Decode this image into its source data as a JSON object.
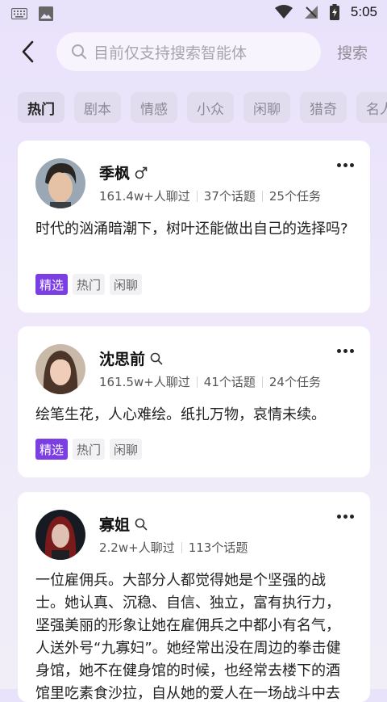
{
  "status_bar": {
    "time": "5:05"
  },
  "search": {
    "placeholder": "目前仅支持搜索智能体",
    "button_label": "搜索"
  },
  "tabs": [
    "热门",
    "剧本",
    "情感",
    "小众",
    "闲聊",
    "猎奇",
    "名人"
  ],
  "cards": [
    {
      "name": "季枫",
      "name_icon": "male-icon",
      "chats": "161.4w+人聊过",
      "topics": "37个话题",
      "tasks": "25个任务",
      "description": "时代的汹涌暗潮下，树叶还能做出自己的选择吗?",
      "tags": [
        "精选",
        "热门",
        "闲聊"
      ]
    },
    {
      "name": "沈思前",
      "name_icon": "search-icon",
      "chats": "161.5w+人聊过",
      "topics": "41个话题",
      "tasks": "24个任务",
      "description": "绘笔生花，人心难绘。纸扎万物，哀情未续。",
      "tags": [
        "精选",
        "热门",
        "闲聊"
      ]
    },
    {
      "name": "寡姐",
      "name_icon": "search-icon",
      "chats": "2.2w+人聊过",
      "topics": "113个话题",
      "description": "一位雇佣兵。大部分人都觉得她是个坚强的战士。她认真、沉稳、自信、独立，富有执行力，坚强美丽的形象让她在雇佣兵之中都小有名气，人送外号“九寡妇”。她经常出没在周边的拳击健身馆，她不在健身馆的时候，也经常去楼下的酒馆里吃素食沙拉，自从她的爱人在一场战斗中去"
    }
  ],
  "colors": {
    "accent": "#7a3ee3",
    "background": "#ebe5fa"
  }
}
